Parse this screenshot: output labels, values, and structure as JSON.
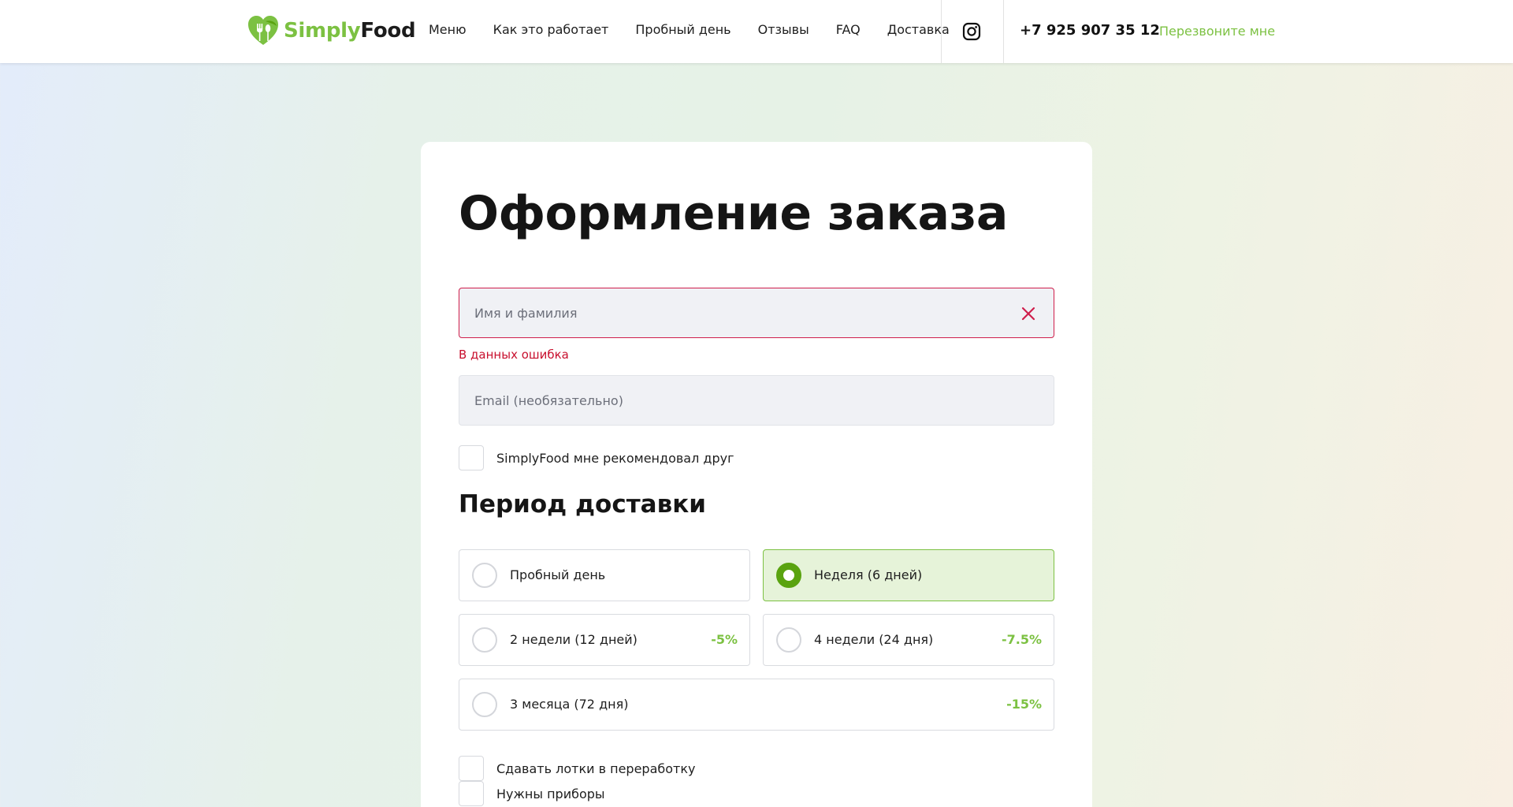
{
  "header": {
    "logo": {
      "part1": "Simply",
      "part2": "Food"
    },
    "nav": [
      "Меню",
      "Как это работает",
      "Пробный день",
      "Отзывы",
      "FAQ",
      "Доставка"
    ],
    "phone": "+7 925 907 35 12",
    "callback": "Перезвоните мне"
  },
  "form": {
    "title": "Оформление заказа",
    "name_field": {
      "placeholder": "Имя и фамилия",
      "error": "В данных ошибка"
    },
    "email_field": {
      "placeholder": "Email (необязательно)"
    },
    "friend_checkbox": {
      "label": "SimplyFood мне рекомендовал друг",
      "checked": false
    },
    "period": {
      "title": "Период доставки",
      "options": [
        {
          "label": "Пробный день",
          "discount": "",
          "selected": false
        },
        {
          "label": "Неделя (6 дней)",
          "discount": "",
          "selected": true
        },
        {
          "label": "2 недели (12 дней)",
          "discount": "-5%",
          "selected": false
        },
        {
          "label": "4 недели (24 дня)",
          "discount": "-7.5%",
          "selected": false
        },
        {
          "label": "3 месяца (72 дня)",
          "discount": "-15%",
          "selected": false
        }
      ]
    },
    "extras": [
      {
        "label": "Сдавать лотки в переработку",
        "checked": false
      },
      {
        "label": "Нужны приборы",
        "checked": false
      }
    ]
  },
  "colors": {
    "brand_green": "#7cc142",
    "radio_green": "#5aa310",
    "error_red": "#cf1e4b"
  }
}
